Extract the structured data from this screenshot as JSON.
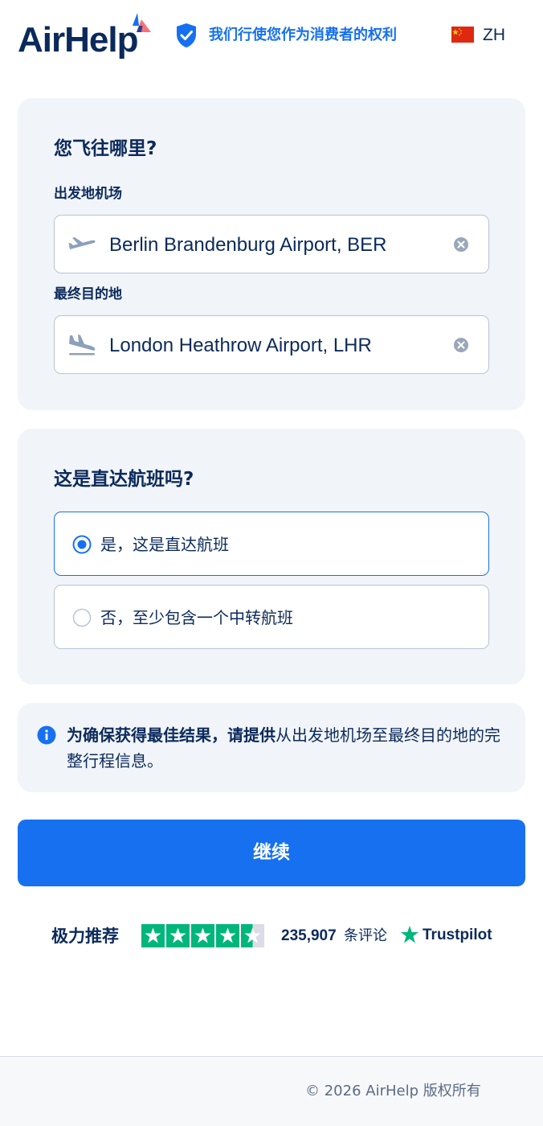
{
  "header": {
    "logo_text": "AirHelp",
    "tagline": "我们行使您作为消费者的权利",
    "language": "ZH"
  },
  "route_card": {
    "title": "您飞往哪里?",
    "departure_label": "出发地机场",
    "departure_value": "Berlin Brandenburg Airport, BER",
    "destination_label": "最终目的地",
    "destination_value": "London Heathrow Airport, LHR"
  },
  "direct_card": {
    "title": "这是直达航班吗?",
    "options": [
      {
        "label": "是，这是直达航班",
        "selected": true
      },
      {
        "label": "否，至少包含一个中转航班",
        "selected": false
      }
    ]
  },
  "info": {
    "bold_text": "为确保获得最佳结果，请提供",
    "text": "从出发地机场至最终目的地的完整行程信息。"
  },
  "continue_button": {
    "label": "继续"
  },
  "trust": {
    "label": "极力推荐",
    "rating_stars": 4.5,
    "review_count": "235,907",
    "review_unit": "条评论",
    "brand": "Trustpilot"
  },
  "footer": {
    "copyright": "© 2026 AirHelp 版权所有"
  },
  "colors": {
    "brand_blue": "#1670f0",
    "navy": "#0b2a5b",
    "card_bg": "#f1f4f9",
    "trustpilot_green": "#00b67a"
  }
}
